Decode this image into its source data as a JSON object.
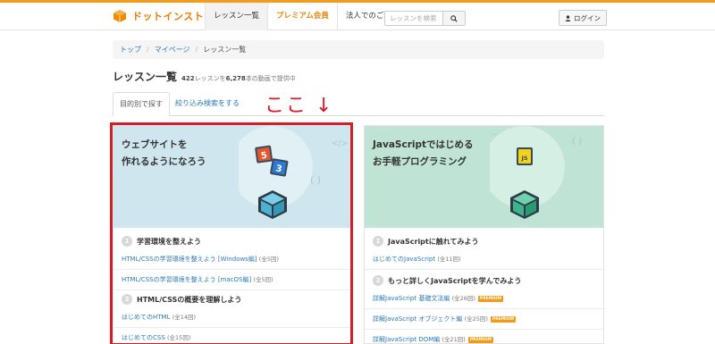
{
  "header": {
    "logo_text": "ドットインストール",
    "nav": [
      {
        "label": "レッスン一覧"
      },
      {
        "label": "プレミアム会員"
      },
      {
        "label": "法人でのご利用"
      }
    ],
    "search_placeholder": "レッスンを検索",
    "login_label": "ログイン",
    "accent_color": "#f59c1a"
  },
  "breadcrumb": {
    "items": [
      "トップ",
      "マイページ",
      "レッスン一覧"
    ],
    "separator": "/"
  },
  "page": {
    "title": "レッスン一覧",
    "sub_count": "422",
    "sub_mid": "レッスンを",
    "sub_videos": "6,278",
    "sub_tail": "本の動画で提供中"
  },
  "tabs": {
    "active": "目的別で探す",
    "link": "絞り込み検索をする"
  },
  "annotation": "ここ ↓",
  "cards": {
    "left": {
      "title_line1": "ウェブサイトを",
      "title_line2": "作れるようになろう",
      "badge1": "5",
      "badge2": "3",
      "sections": [
        {
          "num": "1",
          "title": "学習環境を整えよう",
          "lessons": [
            {
              "title": "HTML/CSSの学習環境を整えよう [Windows編]",
              "count": "(全5回)",
              "premium": false
            },
            {
              "title": "HTML/CSSの学習環境を整えよう [macOS編]",
              "count": "(全5回)",
              "premium": false
            }
          ]
        },
        {
          "num": "2",
          "title": "HTML/CSSの概要を理解しよう",
          "lessons": [
            {
              "title": "はじめてのHTML",
              "count": "(全14回)",
              "premium": false
            },
            {
              "title": "はじめてのCSS",
              "count": "(全15回)",
              "premium": false
            }
          ]
        }
      ]
    },
    "right": {
      "title_line1": "JavaScriptではじめる",
      "title_line2": "お手軽プログラミング",
      "badge": "JS",
      "sections": [
        {
          "num": "1",
          "title": "JavaScriptに触れてみよう",
          "lessons": [
            {
              "title": "はじめてのJavaScript",
              "count": "(全11回)",
              "premium": false
            }
          ]
        },
        {
          "num": "2",
          "title": "もっと詳しくJavaScriptを学んでみよう",
          "lessons": [
            {
              "title": "詳解JavaScript 基礎文法編",
              "count": "(全26回)",
              "premium": true
            },
            {
              "title": "詳解JavaScript オブジェクト編",
              "count": "(全25回)",
              "premium": true
            },
            {
              "title": "詳解JavaScript DOM編",
              "count": "(全21回)",
              "premium": true
            }
          ]
        }
      ]
    },
    "premium_label": "PREMIUM"
  }
}
